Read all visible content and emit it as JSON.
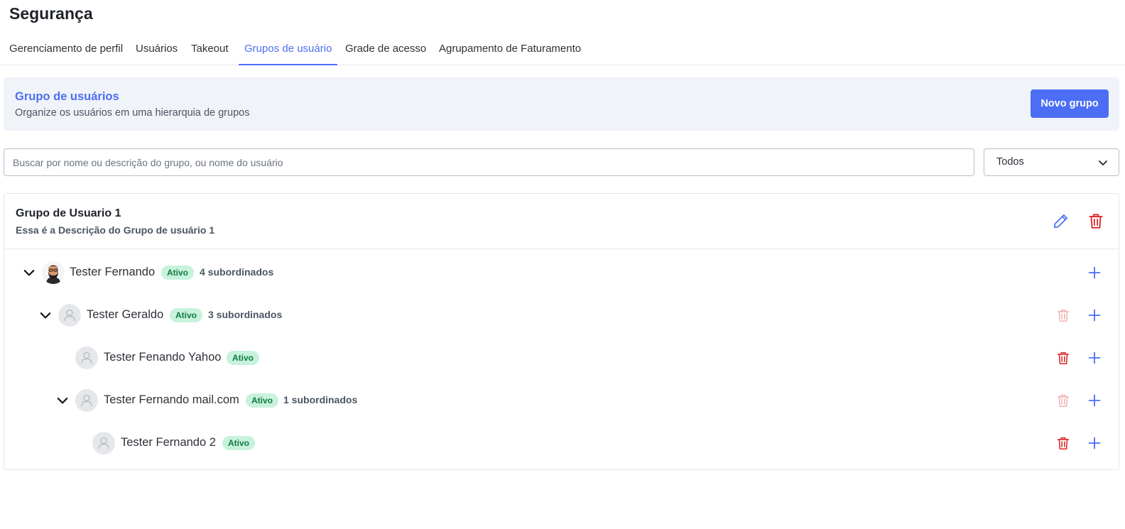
{
  "page": {
    "title": "Segurança"
  },
  "tabs": [
    {
      "label": "Gerenciamento de perfil",
      "active": false
    },
    {
      "label": "Usuários",
      "active": false
    },
    {
      "label": "Takeout",
      "active": false
    },
    {
      "label": "Grupos de usuário",
      "active": true
    },
    {
      "label": "Grade de acesso",
      "active": false
    },
    {
      "label": "Agrupamento de Faturamento",
      "active": false
    }
  ],
  "header": {
    "title": "Grupo de usuários",
    "subtitle": "Organize os usuários em uma hierarquia de grupos",
    "new_button": "Novo grupo"
  },
  "search": {
    "placeholder": "Buscar por nome ou descrição do grupo, ou nome do usuário",
    "value": ""
  },
  "filter": {
    "selected": "Todos"
  },
  "group": {
    "name": "Grupo de Usuario 1",
    "description": "Essa é a Descrição do Grupo de usuário 1",
    "members": [
      {
        "name": "Tester Fernando",
        "status": "Ativo",
        "subordinates": "4 subordinados",
        "level": 0,
        "expandable": true,
        "photo": true,
        "delete": "none"
      },
      {
        "name": "Tester Geraldo",
        "status": "Ativo",
        "subordinates": "3 subordinados",
        "level": 1,
        "expandable": true,
        "photo": false,
        "delete": "disabled"
      },
      {
        "name": "Tester Fenando Yahoo",
        "status": "Ativo",
        "subordinates": "",
        "level": 2,
        "expandable": false,
        "photo": false,
        "delete": "enabled"
      },
      {
        "name": "Tester Fernando mail.com",
        "status": "Ativo",
        "subordinates": "1 subordinados",
        "level": 2,
        "expandable": true,
        "photo": false,
        "delete": "disabled"
      },
      {
        "name": "Tester Fernando 2",
        "status": "Ativo",
        "subordinates": "",
        "level": 3,
        "expandable": false,
        "photo": false,
        "delete": "enabled"
      }
    ]
  },
  "colors": {
    "accent": "#4c6ef5",
    "danger": "#dc2626",
    "badge_bg": "#c7f2dc",
    "badge_text": "#0f7a43",
    "header_bg": "#f0f3f8"
  }
}
